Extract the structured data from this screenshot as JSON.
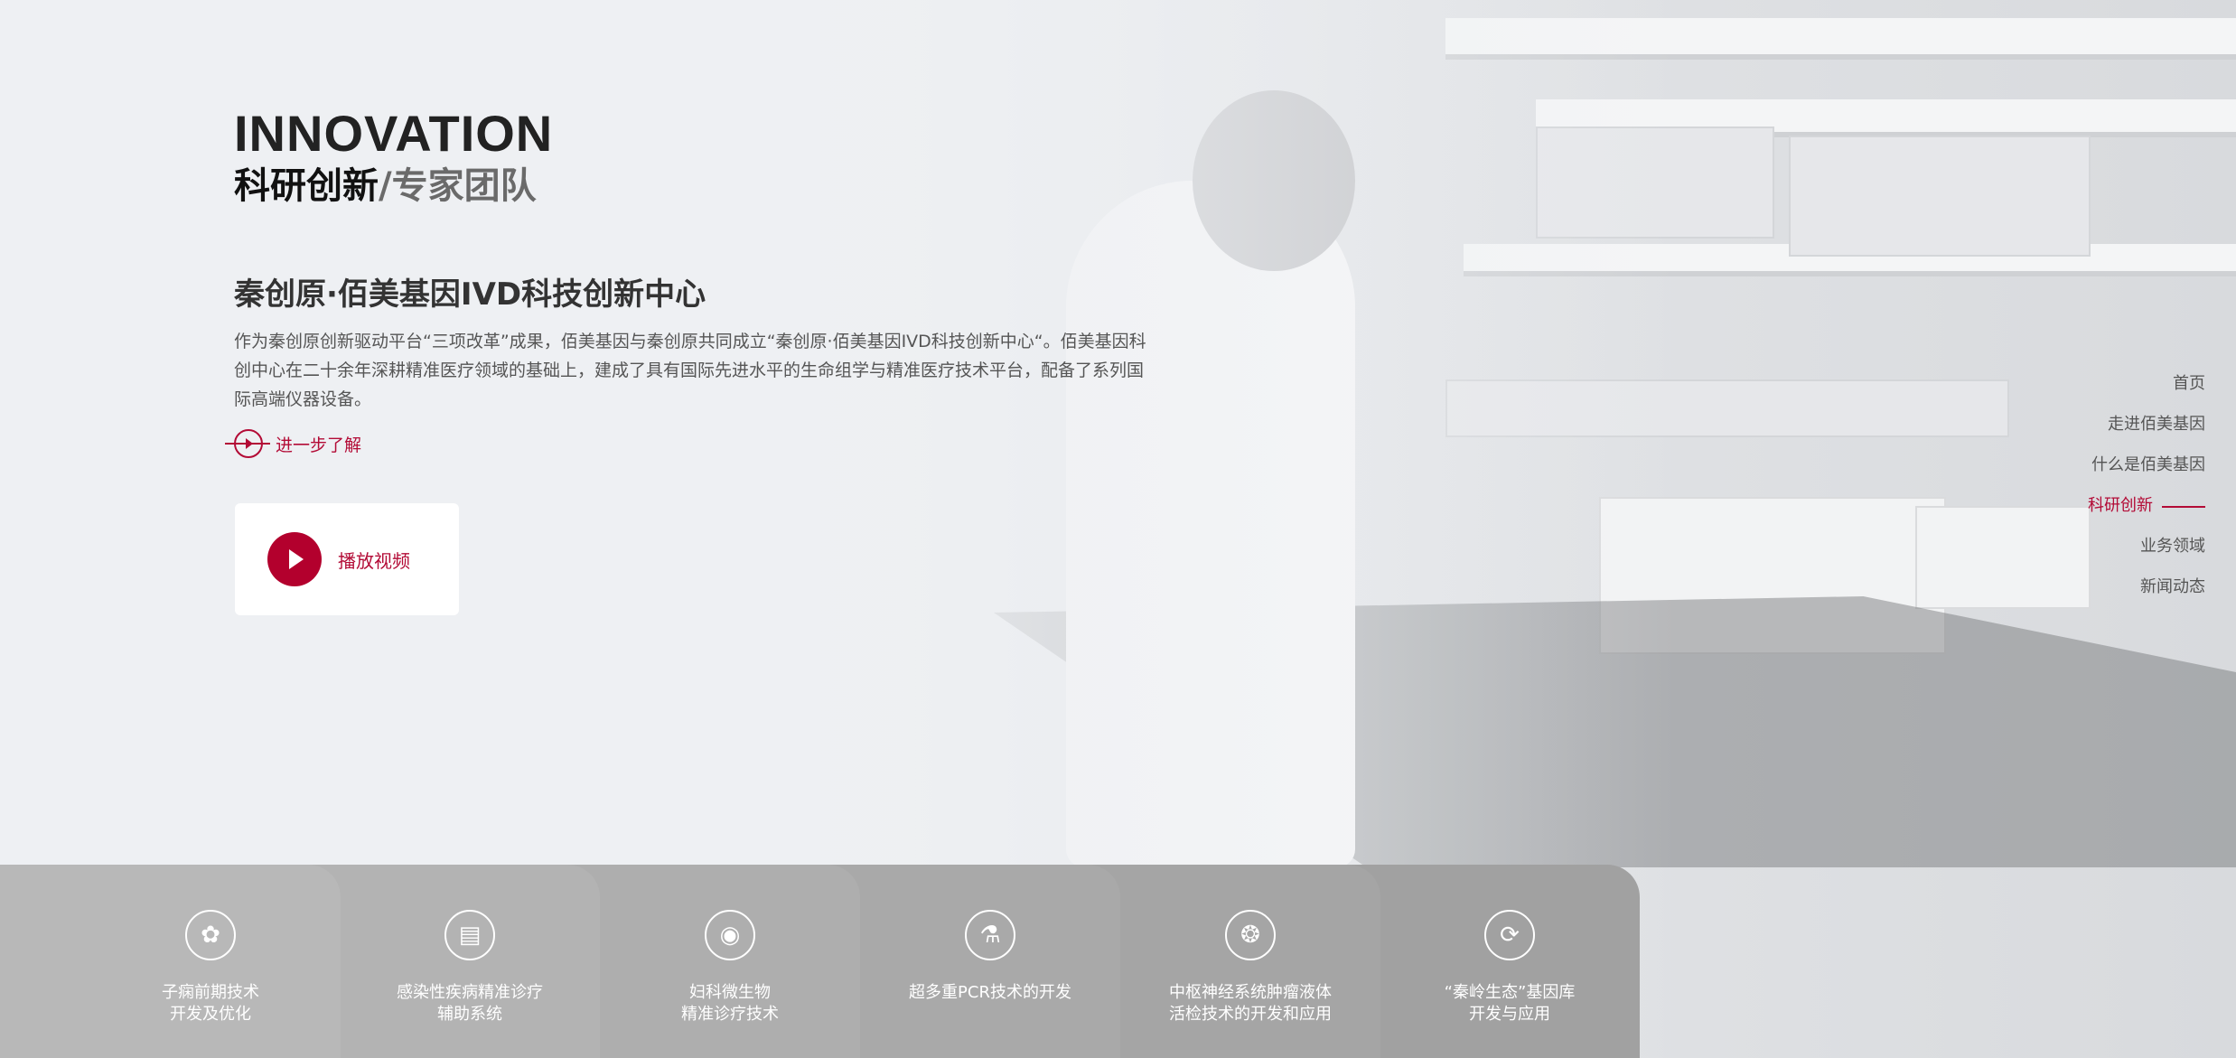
{
  "hero": {
    "title_en": "INNOVATION",
    "title_cn_main": "科研创新",
    "title_cn_sep": "/",
    "title_cn_sub": "专家团队"
  },
  "section": {
    "heading": "秦创原·佰美基因IVD科技创新中心",
    "description": "作为秦创原创新驱动平台“三项改革”成果，佰美基因与秦创原共同成立“秦创原·佰美基因IVD科技创新中心“。佰美基因科创中心在二十余年深耕精准医疗领域的基础上，建成了具有国际先进水平的生命组学与精准医疗技术平台，配备了系列国际高端仪器设备。",
    "more_label": "进一步了解",
    "video_label": "播放视频"
  },
  "sidenav": {
    "items": [
      {
        "label": "首页"
      },
      {
        "label": "走进佰美基因"
      },
      {
        "label": "什么是佰美基因"
      },
      {
        "label": "科研创新"
      },
      {
        "label": "业务领域"
      },
      {
        "label": "新闻动态"
      }
    ],
    "active": "科研创新"
  },
  "tabs": [
    {
      "label": "子痫前期技术\n开发及优化",
      "icon": "flower-icon",
      "color": "#b8b8b8"
    },
    {
      "label": "感染性疾病精准诊疗\n辅助系统",
      "icon": "chart-icon",
      "color": "#b3b3b3"
    },
    {
      "label": "妇科微生物\n精准诊疗技术",
      "icon": "bacteria-icon",
      "color": "#aeaeae"
    },
    {
      "label": "超多重PCR技术的开发",
      "icon": "microscope-icon",
      "color": "#a9a9a9"
    },
    {
      "label": "中枢神经系统肿瘤液体\n活检技术的开发和应用",
      "icon": "neuron-icon",
      "color": "#a5a5a5"
    },
    {
      "label": "“秦岭生态”基因库\n开发与应用",
      "icon": "dna-icon",
      "color": "#a1a1a1"
    }
  ],
  "colors": {
    "accent": "#b3002d"
  }
}
